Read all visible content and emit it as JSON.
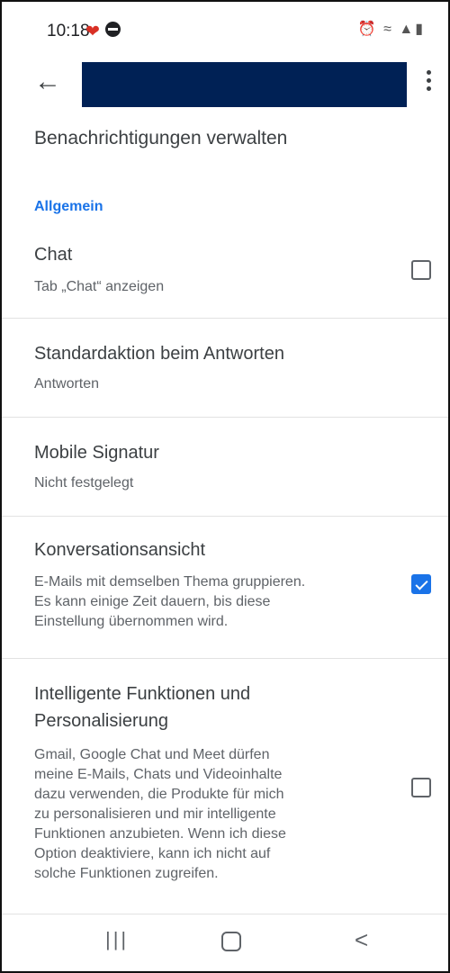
{
  "status_bar": {
    "time": "10:18",
    "heart_icon": "heart-icon",
    "dnd_icon": "do-not-disturb-icon",
    "right_icons": "alarm, wifi, signal, battery"
  },
  "app_bar": {
    "back_icon": "arrow-back-icon",
    "title_redacted": true,
    "more_icon": "more-vert-icon"
  },
  "page_title": "Benachrichtigungen verwalten",
  "section_label": "Allgemein",
  "settings": [
    {
      "title": "Chat",
      "desc": "Tab „Chat“ anzeigen",
      "checkbox": true,
      "checked": false
    },
    {
      "title": "Standardaktion beim Antworten",
      "desc": "Antworten",
      "checkbox": false
    },
    {
      "title": "Mobile Signatur",
      "desc": "Nicht festgelegt",
      "checkbox": false
    },
    {
      "title": "Konversationsansicht",
      "desc_lines": [
        "E-Mails mit demselben Thema gruppieren.",
        "Es kann einige Zeit dauern, bis diese",
        "Einstellung übernommen wird."
      ],
      "checkbox": true,
      "checked": true
    },
    {
      "title_lines": [
        "Intelligente Funktionen und",
        "Personalisierung"
      ],
      "desc_lines": [
        "Gmail, Google Chat und Meet dürfen",
        "meine E-Mails, Chats und Videoinhalte",
        "dazu verwenden, die Produkte für mich",
        "zu personalisieren und mir intelligente",
        "Funktionen anzubieten. Wenn ich diese",
        "Option deaktiviere, kann ich nicht auf",
        "solche Funktionen zugreifen."
      ],
      "checkbox": true,
      "checked": false
    }
  ],
  "nav_bar": {
    "recent_label": "|||",
    "home_icon": "home-icon",
    "back_label": "<"
  },
  "colors": {
    "accent": "#1a73e8",
    "redaction": "#002155",
    "heart": "#d93025"
  }
}
